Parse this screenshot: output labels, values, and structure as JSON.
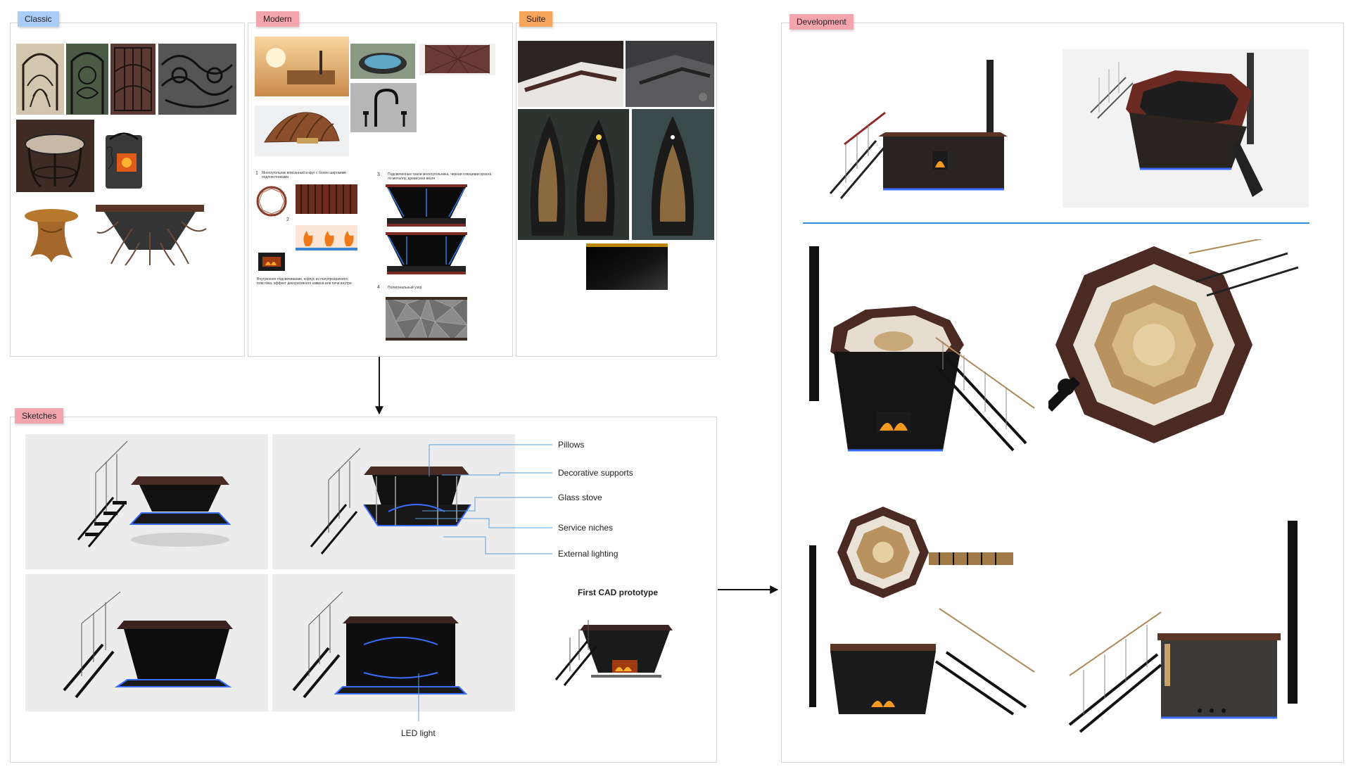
{
  "boards": {
    "classic": {
      "label": "Classic",
      "color": "#a9cdf4"
    },
    "modern": {
      "label": "Modern",
      "color": "#f4a4ac"
    },
    "suite": {
      "label": "Suite",
      "color": "#f7a55c"
    },
    "sketches": {
      "label": "Sketches",
      "color": "#f4a4ac"
    },
    "development": {
      "label": "Development",
      "color": "#f4a4ac"
    }
  },
  "modern_notes": {
    "n1": "1",
    "n1_text": "Многоугольник вписанный в круг с более широкими подлокотниками",
    "n2": "2",
    "n2_text": "Внутреннее подсвечивание, корпус из полупрозрачного пластика, эффект декоративного камина или печи внутри",
    "n3": "3",
    "n3_text": "Подсвеченные грани многоугольника, черная глянцевая краска по металлу, древесина венге",
    "n4": "4",
    "n4_text": "Полигональный узор"
  },
  "callouts": {
    "pillows": "Pillows",
    "supports": "Decorative supports",
    "stove": "Glass stove",
    "niches": "Service niches",
    "lighting": "External lighting",
    "led": "LED light"
  },
  "prototype_title": "First CAD prototype",
  "colors": {
    "accent_line": "#2f8fe0",
    "connector": "#111111",
    "led": "#3a6cff",
    "wood": "#5a3526"
  }
}
